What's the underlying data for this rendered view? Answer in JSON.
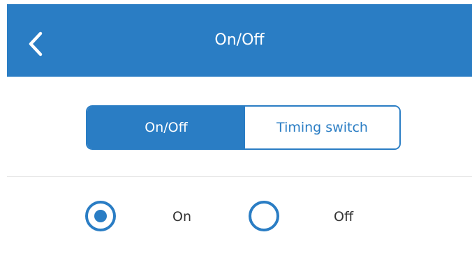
{
  "header": {
    "title": "On/Off",
    "back_icon": "chevron-left-icon",
    "background_color": "#2a7dc4",
    "text_color": "#ffffff"
  },
  "mode_tabs": {
    "items": [
      {
        "label": "On/Off",
        "selected": true
      },
      {
        "label": "Timing switch",
        "selected": false
      }
    ],
    "accent_color": "#2a7dc4"
  },
  "power_options": {
    "items": [
      {
        "label": "On",
        "selected": true
      },
      {
        "label": "Off",
        "selected": false
      }
    ]
  }
}
